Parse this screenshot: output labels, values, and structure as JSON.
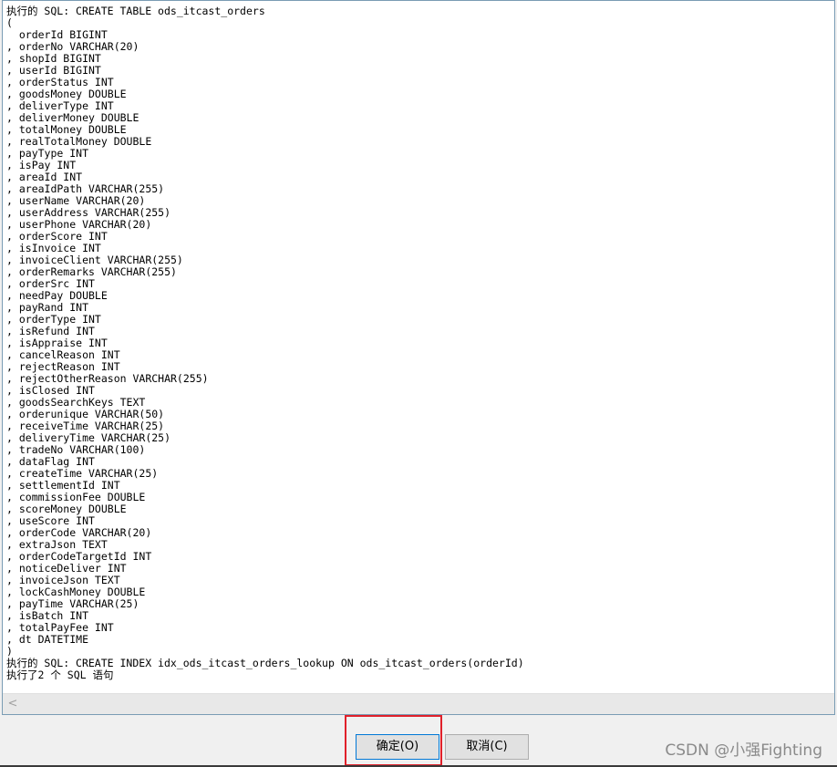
{
  "sql_output": {
    "lines": [
      "执行的 SQL: CREATE TABLE ods_itcast_orders",
      "(",
      "  orderId BIGINT",
      ", orderNo VARCHAR(20)",
      ", shopId BIGINT",
      ", userId BIGINT",
      ", orderStatus INT",
      ", goodsMoney DOUBLE",
      ", deliverType INT",
      ", deliverMoney DOUBLE",
      ", totalMoney DOUBLE",
      ", realTotalMoney DOUBLE",
      ", payType INT",
      ", isPay INT",
      ", areaId INT",
      ", areaIdPath VARCHAR(255)",
      ", userName VARCHAR(20)",
      ", userAddress VARCHAR(255)",
      ", userPhone VARCHAR(20)",
      ", orderScore INT",
      ", isInvoice INT",
      ", invoiceClient VARCHAR(255)",
      ", orderRemarks VARCHAR(255)",
      ", orderSrc INT",
      ", needPay DOUBLE",
      ", payRand INT",
      ", orderType INT",
      ", isRefund INT",
      ", isAppraise INT",
      ", cancelReason INT",
      ", rejectReason INT",
      ", rejectOtherReason VARCHAR(255)",
      ", isClosed INT",
      ", goodsSearchKeys TEXT",
      ", orderunique VARCHAR(50)",
      ", receiveTime VARCHAR(25)",
      ", deliveryTime VARCHAR(25)",
      ", tradeNo VARCHAR(100)",
      ", dataFlag INT",
      ", createTime VARCHAR(25)",
      ", settlementId INT",
      ", commissionFee DOUBLE",
      ", scoreMoney DOUBLE",
      ", useScore INT",
      ", orderCode VARCHAR(20)",
      ", extraJson TEXT",
      ", orderCodeTargetId INT",
      ", noticeDeliver INT",
      ", invoiceJson TEXT",
      ", lockCashMoney DOUBLE",
      ", payTime VARCHAR(25)",
      ", isBatch INT",
      ", totalPayFee INT",
      ", dt DATETIME",
      ")",
      "执行的 SQL: CREATE INDEX idx_ods_itcast_orders_lookup ON ods_itcast_orders(orderId)",
      "执行了2 个 SQL 语句"
    ]
  },
  "scrollbar": {
    "left_arrow": "<"
  },
  "buttons": {
    "ok_label": "确定(O)",
    "cancel_label": "取消(C)"
  },
  "watermark": "CSDN @小强Fighting",
  "colors": {
    "highlight": "#e0202a",
    "default_button_border": "#0078d7"
  }
}
